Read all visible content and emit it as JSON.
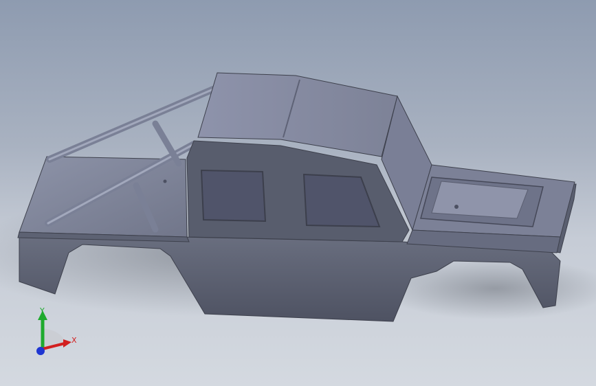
{
  "viewport": {
    "background_top": "#8e9bb0",
    "background_bottom": "#d4d9e0",
    "model_color": "#5f6475"
  },
  "triad": {
    "x_label": "X",
    "y_label": "Y",
    "x_color": "#d21f1f",
    "y_color": "#1faa2e",
    "z_color": "#1f36d2"
  }
}
